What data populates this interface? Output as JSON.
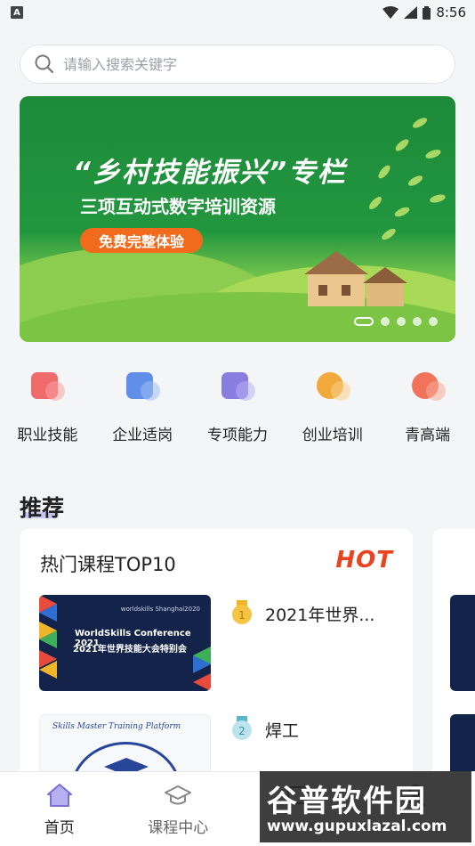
{
  "status_bar": {
    "time": "8:56",
    "notification_letter": "A"
  },
  "search": {
    "placeholder": "请输入搜索关键字"
  },
  "banner": {
    "title": "“乡村技能振兴”专栏",
    "subtitle": "三项互动式数字培训资源",
    "button": "免费完整体验",
    "slide_count": 5,
    "active_slide": 1
  },
  "categories": [
    {
      "label": "职业技能",
      "icon": "briefcase-icon",
      "color": "#f06b6b"
    },
    {
      "label": "企业适岗",
      "icon": "document-icon",
      "color": "#5f8fe8"
    },
    {
      "label": "专项能力",
      "icon": "book-icon",
      "color": "#8a7de0"
    },
    {
      "label": "创业培训",
      "icon": "badge-icon",
      "color": "#f2a93b"
    },
    {
      "label": "青高端",
      "icon": "tag-icon",
      "color": "#f0735a"
    }
  ],
  "recommend": {
    "title": "推荐",
    "card": {
      "title": "热门课程TOP10",
      "badge": "HOT",
      "courses": [
        {
          "rank": "1",
          "name": "2021年世界...",
          "thumb_line1": "WorldSkills Conference 2021",
          "thumb_line2": "2021年世界技能大会特别会",
          "thumb_logo": "worldskills Shanghai2020"
        },
        {
          "rank": "2",
          "name": "焊工",
          "thumb_line1": "Skills Master Training Platform"
        }
      ]
    }
  },
  "tabbar": [
    {
      "label": "首页",
      "icon": "home-icon",
      "active": true
    },
    {
      "label": "课程中心",
      "icon": "graduation-cap-icon",
      "active": false
    },
    {
      "label": "",
      "icon": "partial-tab-icon",
      "active": false
    },
    {
      "label": "",
      "icon": "profile-icon",
      "active": false
    }
  ],
  "watermark": {
    "main": "谷普软件园",
    "url": "www.gupuxlazal.com"
  },
  "colors": {
    "accent": "#f26b1d",
    "banner_green": "#1d8a3a",
    "hot_red": "#e9441f",
    "tab_active": "#7a6fd6"
  }
}
